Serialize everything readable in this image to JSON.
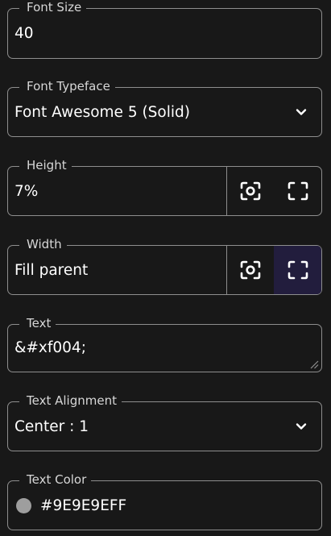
{
  "fields": {
    "font_size": {
      "label": "Font Size",
      "value": "40"
    },
    "font_typeface": {
      "label": "Font Typeface",
      "value": "Font Awesome 5 (Solid)"
    },
    "height": {
      "label": "Height",
      "value": "7%"
    },
    "width": {
      "label": "Width",
      "value": "Fill parent"
    },
    "text": {
      "label": "Text",
      "value": "&#xf004;"
    },
    "text_alignment": {
      "label": "Text Alignment",
      "value": "Center : 1"
    },
    "text_color": {
      "label": "Text Color",
      "value": "#9E9E9EFF",
      "swatch_color": "#9e9e9e"
    }
  },
  "icons": {
    "dropdown": "chevron-down-icon",
    "wrap_content": "focus-frame-icon",
    "fill_parent": "fullscreen-corners-icon",
    "resize": "resize-handle-icon"
  },
  "colors": {
    "background": "#181818",
    "border": "#8e8e8e",
    "label": "#d7d7d7",
    "active_button": "#221d3d"
  }
}
